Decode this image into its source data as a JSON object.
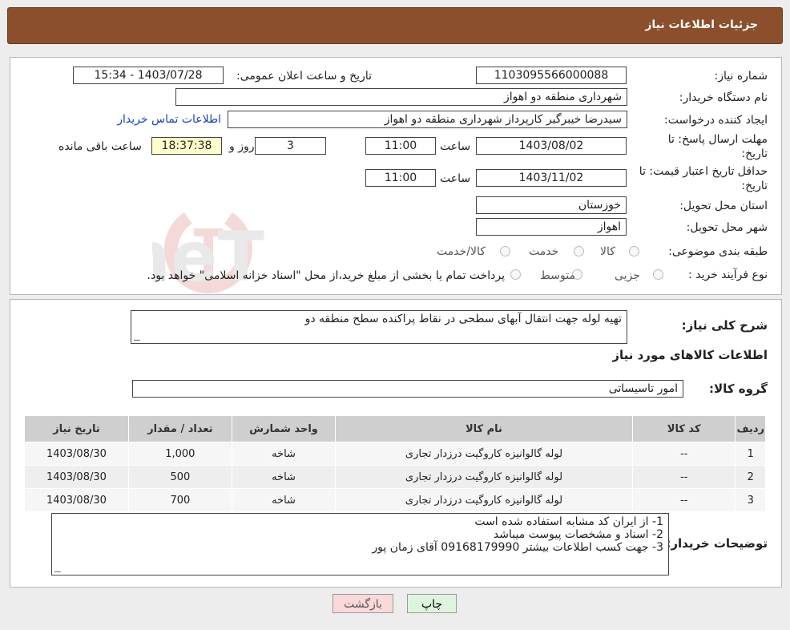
{
  "header": {
    "title": "جزئیات اطلاعات نیاز"
  },
  "form": {
    "need_number_label": "شماره نیاز:",
    "need_number": "1103095566000088",
    "announce_label": "تاریخ و ساعت اعلان عمومی:",
    "announce_value": "1403/07/28 - 15:34",
    "buyer_org_label": "نام دستگاه خریدار:",
    "buyer_org": "شهرداری منطقه دو اهواز",
    "creator_label": "ایجاد کننده درخواست:",
    "creator": "سیدرضا خیبرگیر کارپرداز  شهرداری منطقه دو اهواز",
    "contact_link": "اطلاعات تماس خریدار",
    "reply_deadline_label": "مهلت ارسال پاسخ: تا تاریخ:",
    "reply_date": "1403/08/02",
    "time_label": "ساعت",
    "reply_time": "11:00",
    "days": "3",
    "days_label": "روز و",
    "remaining_time": "18:37:38",
    "remaining_label": "ساعت باقی مانده",
    "price_validity_label": "حداقل تاریخ اعتبار قیمت: تا تاریخ:",
    "price_date": "1403/11/02",
    "price_time": "11:00",
    "province_label": "استان محل تحویل:",
    "province": "خوزستان",
    "city_label": "شهر محل تحویل:",
    "city": "اهواز",
    "category_label": "طبقه بندی موضوعی:",
    "category_options": [
      "کالا",
      "خدمت",
      "کالا/خدمت"
    ],
    "process_label": "نوع فرآیند خرید :",
    "process_options": [
      "جزیی",
      "متوسط"
    ],
    "process_note": "پرداخت تمام یا بخشی از مبلغ خرید،از محل \"اسناد خزانه اسلامی\" خواهد بود."
  },
  "details": {
    "summary_label": "شرح کلی نیاز:",
    "summary": "تهیه لوله جهت انتقال آبهای سطحی در نقاط پراکنده سطح منطقه دو",
    "goods_info_title": "اطلاعات کالاهای مورد نیاز",
    "goods_group_label": "گروه کالا:",
    "goods_group": "امور تاسیساتی",
    "table": {
      "headers": [
        "ردیف",
        "کد کالا",
        "نام کالا",
        "واحد شمارش",
        "تعداد / مقدار",
        "تاریخ نیاز"
      ],
      "rows": [
        [
          "1",
          "--",
          "لوله گالوانیزه کاروگیت درزدار تجاری",
          "شاخه",
          "1,000",
          "1403/08/30"
        ],
        [
          "2",
          "--",
          "لوله گالوانیزه کاروگیت درزدار تجاری",
          "شاخه",
          "500",
          "1403/08/30"
        ],
        [
          "3",
          "--",
          "لوله گالوانیزه کاروگیت درزدار تجاری",
          "شاخه",
          "700",
          "1403/08/30"
        ]
      ]
    },
    "buyer_notes_label": "توضیحات خریدار:",
    "buyer_notes": [
      "1- از ایران کد مشابه استفاده شده است",
      "2- اسناد و مشخصات پیوست میباشد",
      "3- جهت کسب اطلاعات بیشتر 09168179990 آقای زمان پور"
    ]
  },
  "buttons": {
    "print": "چاپ",
    "back": "بازگشت"
  },
  "watermark": {
    "text": "AriaTender.neT"
  },
  "colors": {
    "header_bg": "#8b4f2b",
    "link": "#1a3fc7",
    "back_btn": "#fbd9d9",
    "print_btn": "#ddf5dd"
  }
}
